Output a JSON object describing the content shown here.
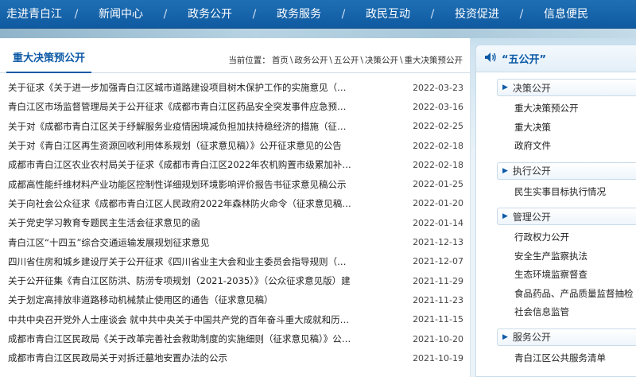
{
  "nav": {
    "items": [
      "走进青白江",
      "新闻中心",
      "政务公开",
      "政务服务",
      "政民互动",
      "投资促进",
      "信息便民"
    ],
    "separator": "/"
  },
  "main": {
    "title": "重大决策预公开",
    "breadcrumb": {
      "prefix": "当前位置：",
      "items": [
        "首页",
        "政务公开",
        "五公开",
        "决策公开",
        "重大决策预公开"
      ],
      "separator": "\\"
    },
    "rows": [
      {
        "title": "关于征求《关于进一步加强青白江区城市道路建设项目树木保护工作的实施意见（…",
        "date": "2022-03-23"
      },
      {
        "title": "青白江区市场监督管理局关于公开征求《成都市青白江区药品安全突发事件应急预…",
        "date": "2022-03-16"
      },
      {
        "title": "关于对《成都市青白江区关于纾解服务业疫情困境减负担加扶持稳经济的措施（征…",
        "date": "2022-02-25"
      },
      {
        "title": "关于对《青白江区再生资源回收利用体系规划（征求意见稿）》公开征求意见的公告",
        "date": "2022-02-18"
      },
      {
        "title": "成都市青白江区农业农村局关于征求《成都市青白江区2022年农机购置市级累加补…",
        "date": "2022-02-18"
      },
      {
        "title": "成都高性能纤维材料产业功能区控制性详细规划环境影响评价报告书征求意见稿公示",
        "date": "2022-01-25"
      },
      {
        "title": "关于向社会公众征求《成都市青白江区人民政府2022年森林防火命令（征求意见稿…",
        "date": "2022-01-20"
      },
      {
        "title": "关于党史学习教育专题民主生活会征求意见的函",
        "date": "2022-01-14"
      },
      {
        "title": "青白江区“十四五”综合交通运输发展规划征求意见",
        "date": "2021-12-13"
      },
      {
        "title": "四川省住房和城乡建设厅关于公开征求《四川省业主大会和业主委员会指导规则（…",
        "date": "2021-12-07"
      },
      {
        "title": "关于公开征集《青白江区防洪、防涝专项规划（2021-2035）》（公众征求意见版）建…",
        "date": "2021-11-29"
      },
      {
        "title": "关于划定高排放非道路移动机械禁止使用区的通告（征求意见稿）",
        "date": "2021-11-23"
      },
      {
        "title": "中共中央召开党外人士座谈会 就中共中央关于中国共产党的百年奋斗重大成就和历…",
        "date": "2021-11-15"
      },
      {
        "title": "成都市青白江区民政局《关于改革完善社会救助制度的实施细则（征求意见稿）》公…",
        "date": "2021-10-20"
      },
      {
        "title": "成都市青白江区民政局关于对拆迁墓地安置办法的公示",
        "date": "2021-10-19"
      }
    ]
  },
  "side": {
    "title": "“五公开”",
    "icon": "speaker-icon",
    "groups": [
      {
        "label": "决策公开",
        "items": [
          "重大决策预公开",
          "重大决策",
          "政府文件"
        ]
      },
      {
        "label": "执行公开",
        "items": [
          "民生实事目标执行情况"
        ]
      },
      {
        "label": "管理公开",
        "items": [
          "行政权力公开",
          "安全生产监察执法",
          "生态环境监察督查",
          "食品药品、产品质量监督抽检",
          "社会信息监管"
        ]
      },
      {
        "label": "服务公开",
        "items": [
          "青白江区公共服务清单"
        ]
      }
    ]
  },
  "colors": {
    "nav_bg": "#1668b0",
    "accent": "#0d5aa6"
  }
}
